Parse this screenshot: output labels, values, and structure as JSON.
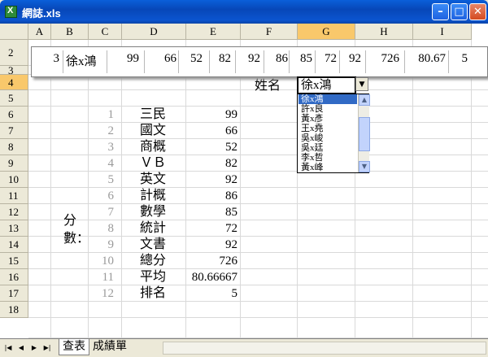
{
  "window": {
    "title": "網誌.xls",
    "buttons": {
      "minimize": "–",
      "maximize": "□",
      "close": "✕"
    }
  },
  "grid": {
    "columns": [
      "A",
      "B",
      "C",
      "D",
      "E",
      "F",
      "G",
      "H",
      "I"
    ],
    "selected_column": "G",
    "rows": [
      "2",
      "3",
      "4",
      "5",
      "6",
      "7",
      "8",
      "9",
      "10",
      "11",
      "12",
      "13",
      "14",
      "15",
      "16",
      "17",
      "18"
    ],
    "selected_row": "4"
  },
  "camera_row": [
    "3",
    "徐x鴻",
    "99",
    "66",
    "52",
    "82",
    "92",
    "86",
    "85",
    "72",
    "92",
    "726",
    "80.67",
    "5"
  ],
  "lookup": {
    "label": "姓名",
    "value": "徐x鴻"
  },
  "dropdown": {
    "items": [
      "徐x鴻",
      "許x良",
      "黃x彥",
      "王x堯",
      "吳x峻",
      "吳x廷",
      "李x哲",
      "黃x峰"
    ],
    "selected_index": 0
  },
  "side_label": "分數：",
  "table": [
    {
      "n": "1",
      "subject": "三民",
      "score": "99"
    },
    {
      "n": "2",
      "subject": "國文",
      "score": "66"
    },
    {
      "n": "3",
      "subject": "商概",
      "score": "52"
    },
    {
      "n": "4",
      "subject": "ＶＢ",
      "score": "82"
    },
    {
      "n": "5",
      "subject": "英文",
      "score": "92"
    },
    {
      "n": "6",
      "subject": "計概",
      "score": "86"
    },
    {
      "n": "7",
      "subject": "數學",
      "score": "85"
    },
    {
      "n": "8",
      "subject": "統計",
      "score": "72"
    },
    {
      "n": "9",
      "subject": "文書",
      "score": "92"
    },
    {
      "n": "10",
      "subject": "總分",
      "score": "726"
    },
    {
      "n": "11",
      "subject": "平均",
      "score": "80.66667"
    },
    {
      "n": "12",
      "subject": "排名",
      "score": "5"
    }
  ],
  "sheet_tabs": {
    "nav": [
      "|◀",
      "◀",
      "▶",
      "▶|"
    ],
    "tabs": [
      "查表",
      "成績單"
    ],
    "active": "查表"
  }
}
